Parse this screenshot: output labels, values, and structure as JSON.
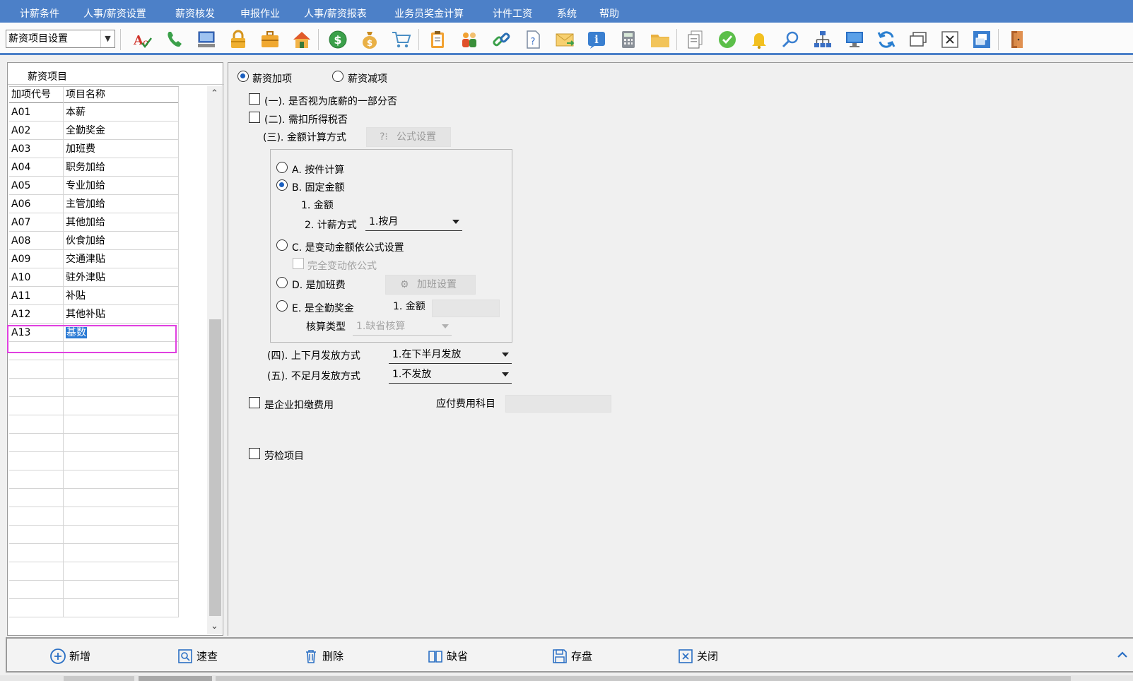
{
  "menu": [
    "计薪条件",
    "人事/薪资设置",
    "薪资核发",
    "申报作业",
    "人事/薪资报表",
    "业务员奖金计算",
    "计件工资",
    "系统",
    "帮助"
  ],
  "module_select": "薪资项目设置",
  "toolbar_icons": [
    "spellcheck-icon",
    "phone-icon",
    "computer-icon",
    "lock-icon",
    "briefcase-icon",
    "home-icon",
    "dollar-icon",
    "moneybag-icon",
    "cart-icon",
    "clipboard-icon",
    "people-icon",
    "link-icon",
    "help-doc-icon",
    "mail-icon",
    "info-icon",
    "calculator-icon",
    "folder-icon",
    "document-icon",
    "check-icon",
    "bell-icon",
    "search-icon",
    "org-chart-icon",
    "monitor-icon",
    "refresh-icon",
    "window-icon",
    "close-window-icon",
    "restore-window-icon",
    "exit-door-icon"
  ],
  "left_panel": {
    "title": "薪资项目",
    "columns": [
      "加项代号",
      "项目名称"
    ],
    "rows": [
      {
        "code": "A01",
        "name": "本薪"
      },
      {
        "code": "A02",
        "name": "全勤奖金"
      },
      {
        "code": "A03",
        "name": "加班费"
      },
      {
        "code": "A04",
        "name": "职务加给"
      },
      {
        "code": "A05",
        "name": "专业加给"
      },
      {
        "code": "A06",
        "name": "主管加给"
      },
      {
        "code": "A07",
        "name": "其他加给"
      },
      {
        "code": "A08",
        "name": "伙食加给"
      },
      {
        "code": "A09",
        "name": "交通津贴"
      },
      {
        "code": "A10",
        "name": "驻外津贴"
      },
      {
        "code": "A11",
        "name": "补贴"
      },
      {
        "code": "A12",
        "name": "其他补贴"
      },
      {
        "code": "A13",
        "name": "基数"
      }
    ],
    "empty_rows": 15
  },
  "form": {
    "type_add": "薪资加项",
    "type_sub": "薪资减项",
    "opt1": "(一). 是否视为底薪的一部分否",
    "opt2": "(二). 需扣所得税否",
    "opt3": "(三). 金额计算方式",
    "formula_btn": "公式设置",
    "method_a": "A. 按件计算",
    "method_b": "B. 固定金额",
    "b_amount": "1. 金额",
    "b_calc_label": "2. 计薪方式",
    "b_calc_value": "1.按月",
    "method_c": "C. 是变动金额依公式设置",
    "c_full": "完全变动依公式",
    "method_d": "D. 是加班费",
    "overtime_btn": "加班设置",
    "method_e": "E. 是全勤奖金",
    "e_amount": "1. 金额",
    "e_check_label": "核算类型",
    "e_check_value": "1.缺省核算",
    "opt4": "(四). 上下月发放方式",
    "opt4_value": "1.在下半月发放",
    "opt5": "(五). 不足月发放方式",
    "opt5_value": "1.不发放",
    "enterprise": "是企业扣缴费用",
    "payable": "应付费用科目",
    "labor": "劳检项目"
  },
  "bottom_buttons": [
    "新增",
    "速查",
    "删除",
    "缺省",
    "存盘",
    "关闭"
  ]
}
